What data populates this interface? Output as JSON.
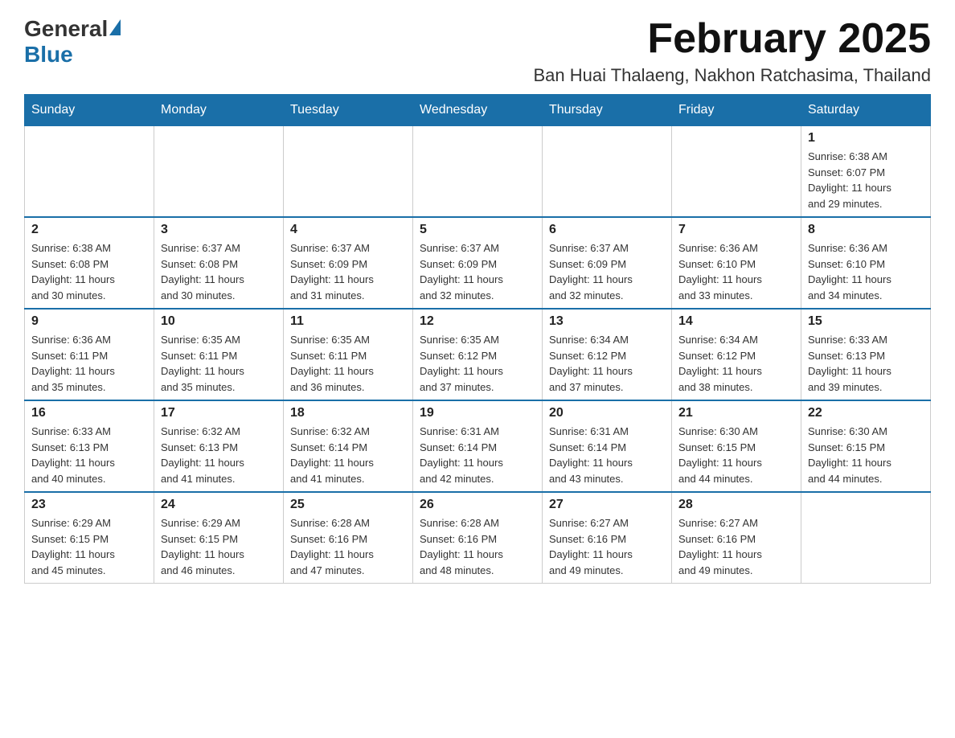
{
  "logo": {
    "general": "General",
    "blue": "Blue"
  },
  "title": {
    "month": "February 2025",
    "location": "Ban Huai Thalaeng, Nakhon Ratchasima, Thailand"
  },
  "weekdays": [
    "Sunday",
    "Monday",
    "Tuesday",
    "Wednesday",
    "Thursday",
    "Friday",
    "Saturday"
  ],
  "weeks": [
    [
      {
        "day": "",
        "info": ""
      },
      {
        "day": "",
        "info": ""
      },
      {
        "day": "",
        "info": ""
      },
      {
        "day": "",
        "info": ""
      },
      {
        "day": "",
        "info": ""
      },
      {
        "day": "",
        "info": ""
      },
      {
        "day": "1",
        "info": "Sunrise: 6:38 AM\nSunset: 6:07 PM\nDaylight: 11 hours\nand 29 minutes."
      }
    ],
    [
      {
        "day": "2",
        "info": "Sunrise: 6:38 AM\nSunset: 6:08 PM\nDaylight: 11 hours\nand 30 minutes."
      },
      {
        "day": "3",
        "info": "Sunrise: 6:37 AM\nSunset: 6:08 PM\nDaylight: 11 hours\nand 30 minutes."
      },
      {
        "day": "4",
        "info": "Sunrise: 6:37 AM\nSunset: 6:09 PM\nDaylight: 11 hours\nand 31 minutes."
      },
      {
        "day": "5",
        "info": "Sunrise: 6:37 AM\nSunset: 6:09 PM\nDaylight: 11 hours\nand 32 minutes."
      },
      {
        "day": "6",
        "info": "Sunrise: 6:37 AM\nSunset: 6:09 PM\nDaylight: 11 hours\nand 32 minutes."
      },
      {
        "day": "7",
        "info": "Sunrise: 6:36 AM\nSunset: 6:10 PM\nDaylight: 11 hours\nand 33 minutes."
      },
      {
        "day": "8",
        "info": "Sunrise: 6:36 AM\nSunset: 6:10 PM\nDaylight: 11 hours\nand 34 minutes."
      }
    ],
    [
      {
        "day": "9",
        "info": "Sunrise: 6:36 AM\nSunset: 6:11 PM\nDaylight: 11 hours\nand 35 minutes."
      },
      {
        "day": "10",
        "info": "Sunrise: 6:35 AM\nSunset: 6:11 PM\nDaylight: 11 hours\nand 35 minutes."
      },
      {
        "day": "11",
        "info": "Sunrise: 6:35 AM\nSunset: 6:11 PM\nDaylight: 11 hours\nand 36 minutes."
      },
      {
        "day": "12",
        "info": "Sunrise: 6:35 AM\nSunset: 6:12 PM\nDaylight: 11 hours\nand 37 minutes."
      },
      {
        "day": "13",
        "info": "Sunrise: 6:34 AM\nSunset: 6:12 PM\nDaylight: 11 hours\nand 37 minutes."
      },
      {
        "day": "14",
        "info": "Sunrise: 6:34 AM\nSunset: 6:12 PM\nDaylight: 11 hours\nand 38 minutes."
      },
      {
        "day": "15",
        "info": "Sunrise: 6:33 AM\nSunset: 6:13 PM\nDaylight: 11 hours\nand 39 minutes."
      }
    ],
    [
      {
        "day": "16",
        "info": "Sunrise: 6:33 AM\nSunset: 6:13 PM\nDaylight: 11 hours\nand 40 minutes."
      },
      {
        "day": "17",
        "info": "Sunrise: 6:32 AM\nSunset: 6:13 PM\nDaylight: 11 hours\nand 41 minutes."
      },
      {
        "day": "18",
        "info": "Sunrise: 6:32 AM\nSunset: 6:14 PM\nDaylight: 11 hours\nand 41 minutes."
      },
      {
        "day": "19",
        "info": "Sunrise: 6:31 AM\nSunset: 6:14 PM\nDaylight: 11 hours\nand 42 minutes."
      },
      {
        "day": "20",
        "info": "Sunrise: 6:31 AM\nSunset: 6:14 PM\nDaylight: 11 hours\nand 43 minutes."
      },
      {
        "day": "21",
        "info": "Sunrise: 6:30 AM\nSunset: 6:15 PM\nDaylight: 11 hours\nand 44 minutes."
      },
      {
        "day": "22",
        "info": "Sunrise: 6:30 AM\nSunset: 6:15 PM\nDaylight: 11 hours\nand 44 minutes."
      }
    ],
    [
      {
        "day": "23",
        "info": "Sunrise: 6:29 AM\nSunset: 6:15 PM\nDaylight: 11 hours\nand 45 minutes."
      },
      {
        "day": "24",
        "info": "Sunrise: 6:29 AM\nSunset: 6:15 PM\nDaylight: 11 hours\nand 46 minutes."
      },
      {
        "day": "25",
        "info": "Sunrise: 6:28 AM\nSunset: 6:16 PM\nDaylight: 11 hours\nand 47 minutes."
      },
      {
        "day": "26",
        "info": "Sunrise: 6:28 AM\nSunset: 6:16 PM\nDaylight: 11 hours\nand 48 minutes."
      },
      {
        "day": "27",
        "info": "Sunrise: 6:27 AM\nSunset: 6:16 PM\nDaylight: 11 hours\nand 49 minutes."
      },
      {
        "day": "28",
        "info": "Sunrise: 6:27 AM\nSunset: 6:16 PM\nDaylight: 11 hours\nand 49 minutes."
      },
      {
        "day": "",
        "info": ""
      }
    ]
  ]
}
